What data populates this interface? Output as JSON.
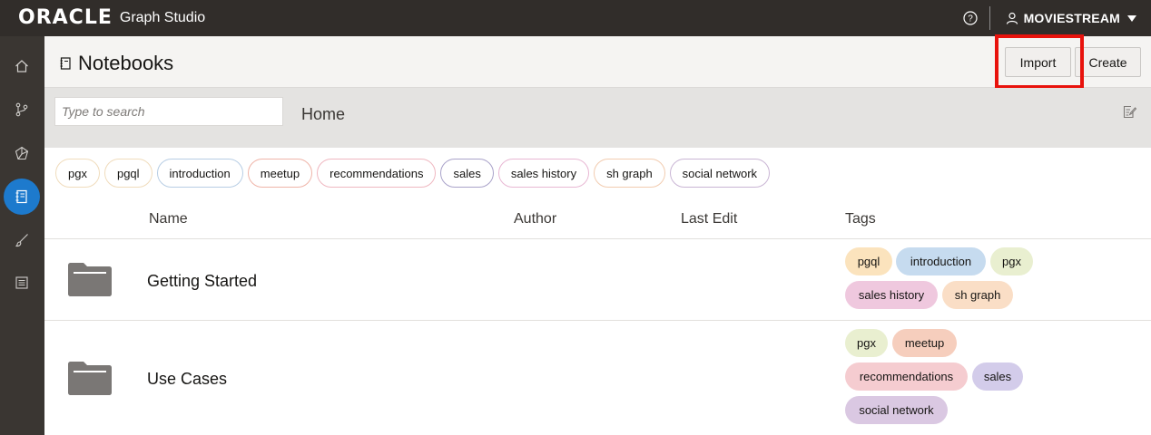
{
  "topbar": {
    "logo_text": "ORACLE",
    "product_name": "Graph Studio",
    "help_icon": "help-icon",
    "user_name": "MOVIESTREAM"
  },
  "leftrail": {
    "items": [
      {
        "icon": "home-icon"
      },
      {
        "icon": "graph-branch-icon"
      },
      {
        "icon": "models-icon"
      },
      {
        "icon": "notebook-icon",
        "active": true
      },
      {
        "icon": "brush-icon"
      },
      {
        "icon": "jobs-list-icon"
      }
    ]
  },
  "header": {
    "title": "Notebooks",
    "import_label": "Import",
    "create_label": "Create"
  },
  "search": {
    "placeholder": "Type to search",
    "breadcrumb": "Home"
  },
  "filter_tags": [
    "pgx",
    "pgql",
    "introduction",
    "meetup",
    "recommendations",
    "sales",
    "sales history",
    "sh graph",
    "social network"
  ],
  "table": {
    "columns": {
      "name": "Name",
      "author": "Author",
      "last_edit": "Last Edit",
      "tags": "Tags"
    },
    "rows": [
      {
        "name": "Getting Started",
        "author": "",
        "last_edit": "",
        "tags": [
          "pgql",
          "introduction",
          "pgx",
          "sales history",
          "sh graph"
        ]
      },
      {
        "name": "Use Cases",
        "author": "",
        "last_edit": "",
        "tags": [
          "pgx",
          "meetup",
          "recommendations",
          "sales",
          "social network"
        ]
      }
    ]
  },
  "colors": {
    "topbar": "#312d2a",
    "rail": "#3a3632",
    "active_accent": "#1d7acd",
    "highlight": "#e8120c",
    "tag_pgql": "#fbe3bd",
    "tag_introduction": "#c6dbef",
    "tag_pgx": "#e9efd0",
    "tag_sales_history": "#efc8de",
    "tag_sh_graph": "#fadec6",
    "tag_meetup": "#f6cebd",
    "tag_recommendations": "#f5ccd0",
    "tag_sales": "#d3ccea",
    "tag_social_network": "#dac8e2"
  }
}
